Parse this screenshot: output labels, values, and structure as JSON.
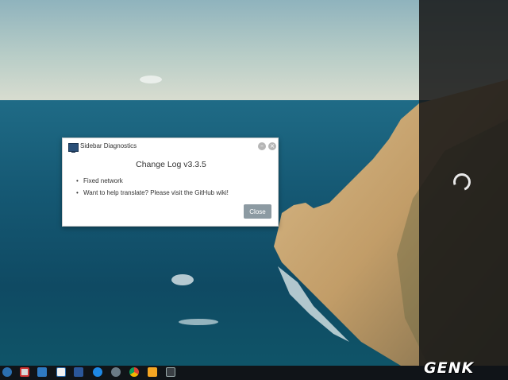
{
  "dialog": {
    "app_title": "Sidebar Diagnostics",
    "heading": "Change Log v3.3.5",
    "changes": [
      "Fixed network",
      "Want to help translate? Please visit the GitHub wiki!"
    ],
    "close_label": "Close",
    "bullet": "•",
    "minimize_glyph": "–",
    "close_glyph": "×"
  },
  "sidebar": {
    "status": "loading"
  },
  "taskbar": {
    "icons": [
      "settings-icon",
      "mail-icon",
      "network-icon",
      "outlook-icon",
      "word-icon",
      "browser-icon",
      "app-icon",
      "chrome-icon",
      "media-player-icon",
      "window-icon"
    ]
  },
  "watermark": {
    "text": "GENK"
  },
  "colors": {
    "close_button": "#8c9aa2",
    "taskbar": "#101418",
    "sidebar": "#161616"
  }
}
